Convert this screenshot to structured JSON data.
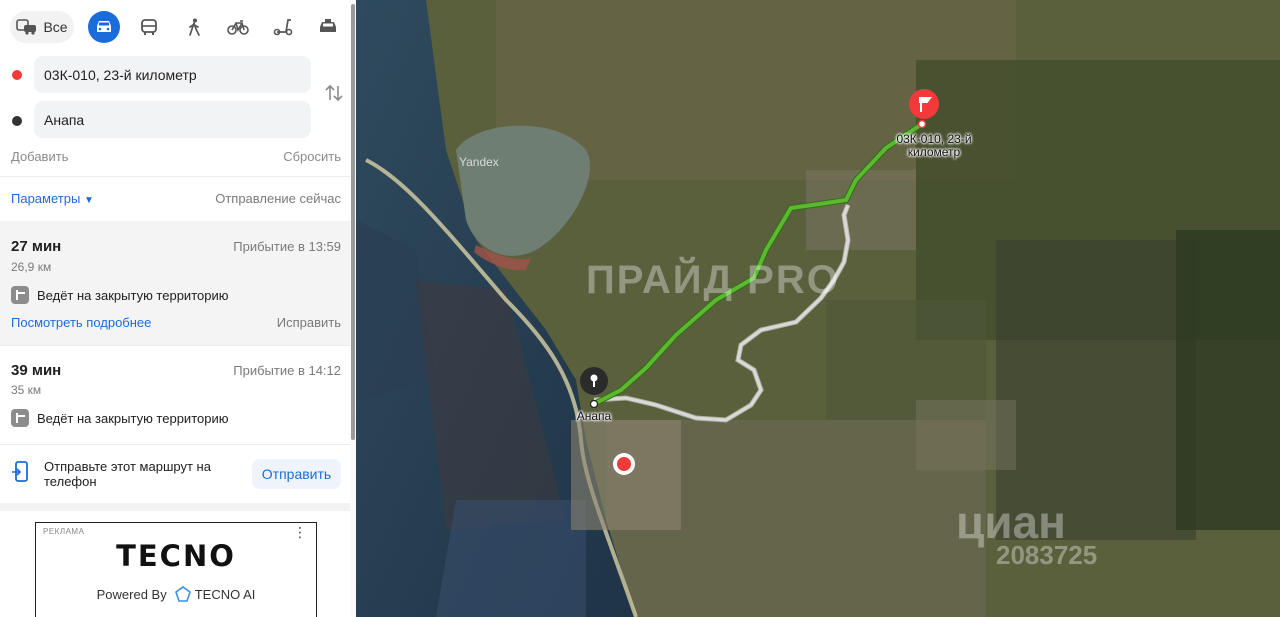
{
  "modes": {
    "all_label": "Все",
    "items": [
      "car-icon",
      "bus-icon",
      "walk-icon",
      "bicycle-icon",
      "scooter-icon",
      "taxi-icon"
    ],
    "active": "car"
  },
  "from": {
    "value": "03К-010, 23-й километр",
    "dot_color": "#f33a3a"
  },
  "to": {
    "value": "Анапа",
    "dot_color": "#333333"
  },
  "actions": {
    "add": "Добавить",
    "reset": "Сбросить"
  },
  "options": {
    "params": "Параметры",
    "departure": "Отправление сейчас"
  },
  "routes": [
    {
      "time": "27 мин",
      "arrival": "Прибытие в 13:59",
      "distance": "26,9 км",
      "warning": "Ведёт на закрытую территорию",
      "details_link": "Посмотреть подробнее",
      "fix_link": "Исправить"
    },
    {
      "time": "39 мин",
      "arrival": "Прибытие в 14:12",
      "distance": "35 км",
      "warning": "Ведёт на закрытую территорию"
    }
  ],
  "send": {
    "text": "Отправьте этот маршрут на телефон",
    "button": "Отправить"
  },
  "ad": {
    "label": "РЕКЛАМА",
    "brand": "TECNO",
    "powered_prefix": "Powered By",
    "powered_name": "TECNO AI"
  },
  "map": {
    "start_label": "03К-010, 23-й километр",
    "end_label": "Анапа",
    "yandex_label": "Yandex",
    "watermark_1": "ПРАЙД PRO",
    "watermark_2": "циан",
    "watermark_3": "2083725",
    "route_color": "#5cb82f",
    "alt_route_color": "#d9d9d9",
    "pin_red": "#f33a3a"
  },
  "colors": {
    "accent": "#1a6dd8",
    "text": "#21201f",
    "secondary": "#7a7a7a"
  }
}
